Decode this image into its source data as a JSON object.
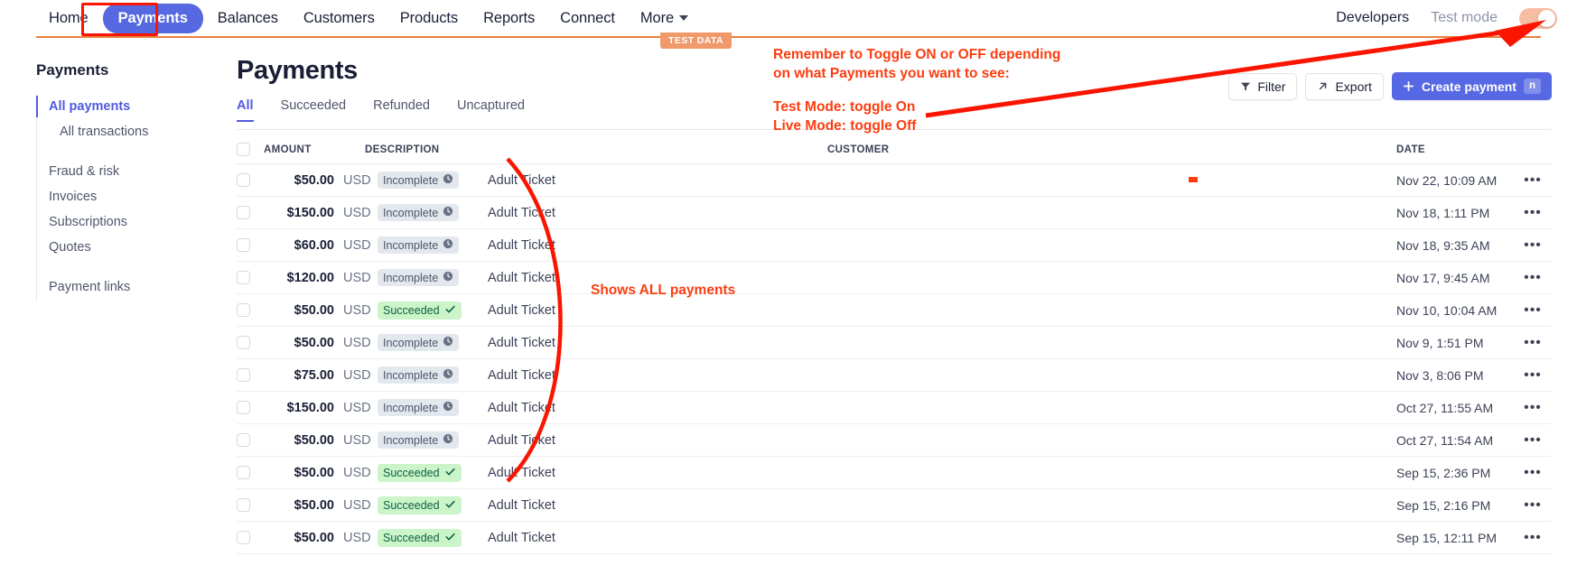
{
  "topnav": {
    "items": [
      {
        "label": "Home",
        "active": false
      },
      {
        "label": "Payments",
        "active": true
      },
      {
        "label": "Balances",
        "active": false
      },
      {
        "label": "Customers",
        "active": false
      },
      {
        "label": "Products",
        "active": false
      },
      {
        "label": "Reports",
        "active": false
      },
      {
        "label": "Connect",
        "active": false
      },
      {
        "label": "More",
        "active": false
      }
    ],
    "developers_label": "Developers",
    "test_mode_label": "Test mode",
    "test_mode_on": true,
    "test_data_chip": "TEST DATA"
  },
  "sidebar": {
    "title": "Payments",
    "items": [
      {
        "label": "All payments",
        "active": true,
        "sub": false
      },
      {
        "label": "All transactions",
        "active": false,
        "sub": true
      },
      {
        "label": "Fraud & risk",
        "active": false,
        "sub": false
      },
      {
        "label": "Invoices",
        "active": false,
        "sub": false
      },
      {
        "label": "Subscriptions",
        "active": false,
        "sub": false
      },
      {
        "label": "Quotes",
        "active": false,
        "sub": false
      },
      {
        "label": "Payment links",
        "active": false,
        "sub": false
      }
    ]
  },
  "main": {
    "page_title": "Payments",
    "tabs": [
      {
        "label": "All",
        "active": true
      },
      {
        "label": "Succeeded",
        "active": false
      },
      {
        "label": "Refunded",
        "active": false
      },
      {
        "label": "Uncaptured",
        "active": false
      }
    ],
    "toolbar": {
      "filter_label": "Filter",
      "export_label": "Export",
      "create_label": "Create payment",
      "create_shortcut": "n"
    }
  },
  "table": {
    "columns": [
      "AMOUNT",
      "DESCRIPTION",
      "CUSTOMER",
      "DATE"
    ],
    "rows": [
      {
        "amount": "$50.00",
        "currency": "USD",
        "status": "Incomplete",
        "status_kind": "incomplete",
        "description": "Adult Ticket",
        "customer": "",
        "date": "Nov 22, 10:09 AM"
      },
      {
        "amount": "$150.00",
        "currency": "USD",
        "status": "Incomplete",
        "status_kind": "incomplete",
        "description": "Adult Ticket",
        "customer": "",
        "date": "Nov 18, 1:11 PM"
      },
      {
        "amount": "$60.00",
        "currency": "USD",
        "status": "Incomplete",
        "status_kind": "incomplete",
        "description": "Adult Ticket",
        "customer": "",
        "date": "Nov 18, 9:35 AM"
      },
      {
        "amount": "$120.00",
        "currency": "USD",
        "status": "Incomplete",
        "status_kind": "incomplete",
        "description": "Adult Ticket",
        "customer": "",
        "date": "Nov 17, 9:45 AM"
      },
      {
        "amount": "$50.00",
        "currency": "USD",
        "status": "Succeeded",
        "status_kind": "succeeded",
        "description": "Adult Ticket",
        "customer": "",
        "date": "Nov 10, 10:04 AM"
      },
      {
        "amount": "$50.00",
        "currency": "USD",
        "status": "Incomplete",
        "status_kind": "incomplete",
        "description": "Adult Ticket",
        "customer": "",
        "date": "Nov 9, 1:51 PM"
      },
      {
        "amount": "$75.00",
        "currency": "USD",
        "status": "Incomplete",
        "status_kind": "incomplete",
        "description": "Adult Ticket",
        "customer": "",
        "date": "Nov 3, 8:06 PM"
      },
      {
        "amount": "$150.00",
        "currency": "USD",
        "status": "Incomplete",
        "status_kind": "incomplete",
        "description": "Adult Ticket",
        "customer": "",
        "date": "Oct 27, 11:55 AM"
      },
      {
        "amount": "$50.00",
        "currency": "USD",
        "status": "Incomplete",
        "status_kind": "incomplete",
        "description": "Adult Ticket",
        "customer": "",
        "date": "Oct 27, 11:54 AM"
      },
      {
        "amount": "$50.00",
        "currency": "USD",
        "status": "Succeeded",
        "status_kind": "succeeded",
        "description": "Adult Ticket",
        "customer": "",
        "date": "Sep 15, 2:36 PM"
      },
      {
        "amount": "$50.00",
        "currency": "USD",
        "status": "Succeeded",
        "status_kind": "succeeded",
        "description": "Adult Ticket",
        "customer": "",
        "date": "Sep 15, 2:16 PM"
      },
      {
        "amount": "$50.00",
        "currency": "USD",
        "status": "Succeeded",
        "status_kind": "succeeded",
        "description": "Adult Ticket",
        "customer": "",
        "date": "Sep 15, 12:11 PM"
      }
    ],
    "row_menu_glyph": "•••"
  },
  "annotations": {
    "toggle_note": "Remember to Toggle ON or OFF depending\non what Payments you want to see:",
    "modes_note": "Test Mode: toggle On\nLive Mode: toggle Off",
    "all_payments_note": "Shows ALL payments",
    "color": "#fb3d10"
  }
}
